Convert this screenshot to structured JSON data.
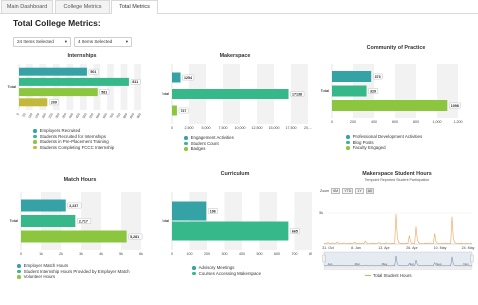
{
  "tabs": [
    {
      "label": "Main Dashboard"
    },
    {
      "label": "College Metrics"
    },
    {
      "label": "Total Metrics"
    }
  ],
  "page_title": "Total College Metrics:",
  "filters": {
    "filter1": "24 Items Selected",
    "filter2": "4 Items Selected"
  },
  "colors": {
    "teal": "#35a3a6",
    "green": "#36b88a",
    "lime": "#8cc63f",
    "olive": "#c2b93a",
    "blue": "#3f86c4",
    "orange": "#f0a35e"
  },
  "chart_data": [
    {
      "type": "bar",
      "title": "Internships",
      "category": "Total",
      "series": [
        {
          "name": "Employers Recruited",
          "value": 501
        },
        {
          "name": "Students Recruited for Internships",
          "value": 811
        },
        {
          "name": "Students in Pre-Placement Training",
          "value": 581
        },
        {
          "name": "Students Completing FCCC Internship",
          "value": 209
        }
      ],
      "ticks": [
        "0",
        "50",
        "100",
        "150",
        "200",
        "250",
        "300",
        "350",
        "400",
        "450",
        "500",
        "550",
        "600",
        "650",
        "700",
        "750",
        "800",
        "850",
        "900"
      ],
      "xlim": [
        0,
        900
      ]
    },
    {
      "type": "bar",
      "title": "Makerspace",
      "category": "Total",
      "series": [
        {
          "name": "Engagement Activities",
          "value": 1254
        },
        {
          "name": "Student Count",
          "value": 17138
        },
        {
          "name": "Badges",
          "value": 727
        }
      ],
      "ticks": [
        "0",
        "2,500",
        "5,000",
        "7,500",
        "10,000",
        "12,500",
        "15,000",
        "17,500",
        "20,..."
      ],
      "xlim": [
        0,
        20000
      ]
    },
    {
      "type": "bar",
      "title": "Community of Practice",
      "category": "Total",
      "series": [
        {
          "name": "Professional Development Activities",
          "value": 373
        },
        {
          "name": "Blog Posts",
          "value": 329
        },
        {
          "name": "Faculty Engaged",
          "value": 1098
        }
      ],
      "ticks": [
        "0",
        "200",
        "400",
        "600",
        "800",
        "1,000",
        "1,200"
      ],
      "xlim": [
        0,
        1200
      ]
    },
    {
      "type": "bar",
      "title": "Match Hours",
      "category": "Total",
      "series": [
        {
          "name": "Employer Match Hours",
          "value": 2237
        },
        {
          "name": "Student Internship Hours Provided by Employer Match",
          "value": 2717
        },
        {
          "name": "Volunteer Hours",
          "value": 5281
        }
      ],
      "series_labels": [
        "2,237",
        "2,717",
        "5,281"
      ],
      "ticks": [
        "0",
        "1k",
        "2k",
        "3k",
        "4k",
        "5k",
        "6k"
      ],
      "xlim": [
        0,
        6000
      ]
    },
    {
      "type": "bar",
      "title": "Curriculum",
      "category": "Total",
      "series": [
        {
          "name": "Advisory Meetings",
          "value": 196
        },
        {
          "name": "Courses Accessing Makerspace",
          "value": 665
        }
      ],
      "ticks": [
        "0",
        "100",
        "200",
        "300",
        "400",
        "500",
        "600",
        "700",
        "800"
      ],
      "xlim": [
        0,
        800
      ]
    },
    {
      "type": "line",
      "title": "Makerspace Student Hours",
      "subtitle": "Tempoint Reported Student Participation",
      "zoom_label": "Zoom",
      "zoom_options": [
        "6M",
        "YTD",
        "1Y",
        "All"
      ],
      "ytick": "5k",
      "x_ticks": [
        "31. Oct",
        "8. Jan",
        "13. Apr",
        "26. Apr",
        "10. May",
        "24. May"
      ],
      "navigator_ticks": [
        "Jan",
        "Mar",
        "May",
        "Jul",
        "Sep",
        "Nov"
      ],
      "legend": "Total Student Hours",
      "values": [
        120,
        80,
        60,
        200,
        90,
        70,
        150,
        110,
        60,
        90,
        300,
        120,
        80,
        70,
        100,
        160,
        90,
        60,
        80,
        120,
        110,
        70,
        90,
        260,
        100,
        80,
        60,
        120,
        90,
        70,
        110,
        420,
        140,
        80,
        70,
        90,
        130,
        100,
        80,
        60,
        90,
        200,
        120,
        70,
        60,
        80,
        110,
        150,
        90,
        70,
        60,
        100,
        80,
        120,
        4300,
        900,
        200,
        120,
        90,
        100,
        80,
        70,
        140,
        100,
        1200,
        300,
        90,
        80,
        120,
        2500,
        600,
        200,
        100,
        80,
        70,
        90,
        120,
        100,
        80,
        160,
        140,
        90,
        80,
        1500,
        300,
        120,
        90,
        80,
        70,
        100,
        90,
        80,
        120,
        90,
        100,
        80,
        3900,
        800,
        200,
        100,
        80,
        90,
        100,
        120,
        80,
        70,
        90,
        100,
        80,
        70,
        60,
        80
      ],
      "ylim": [
        0,
        6000
      ]
    }
  ]
}
